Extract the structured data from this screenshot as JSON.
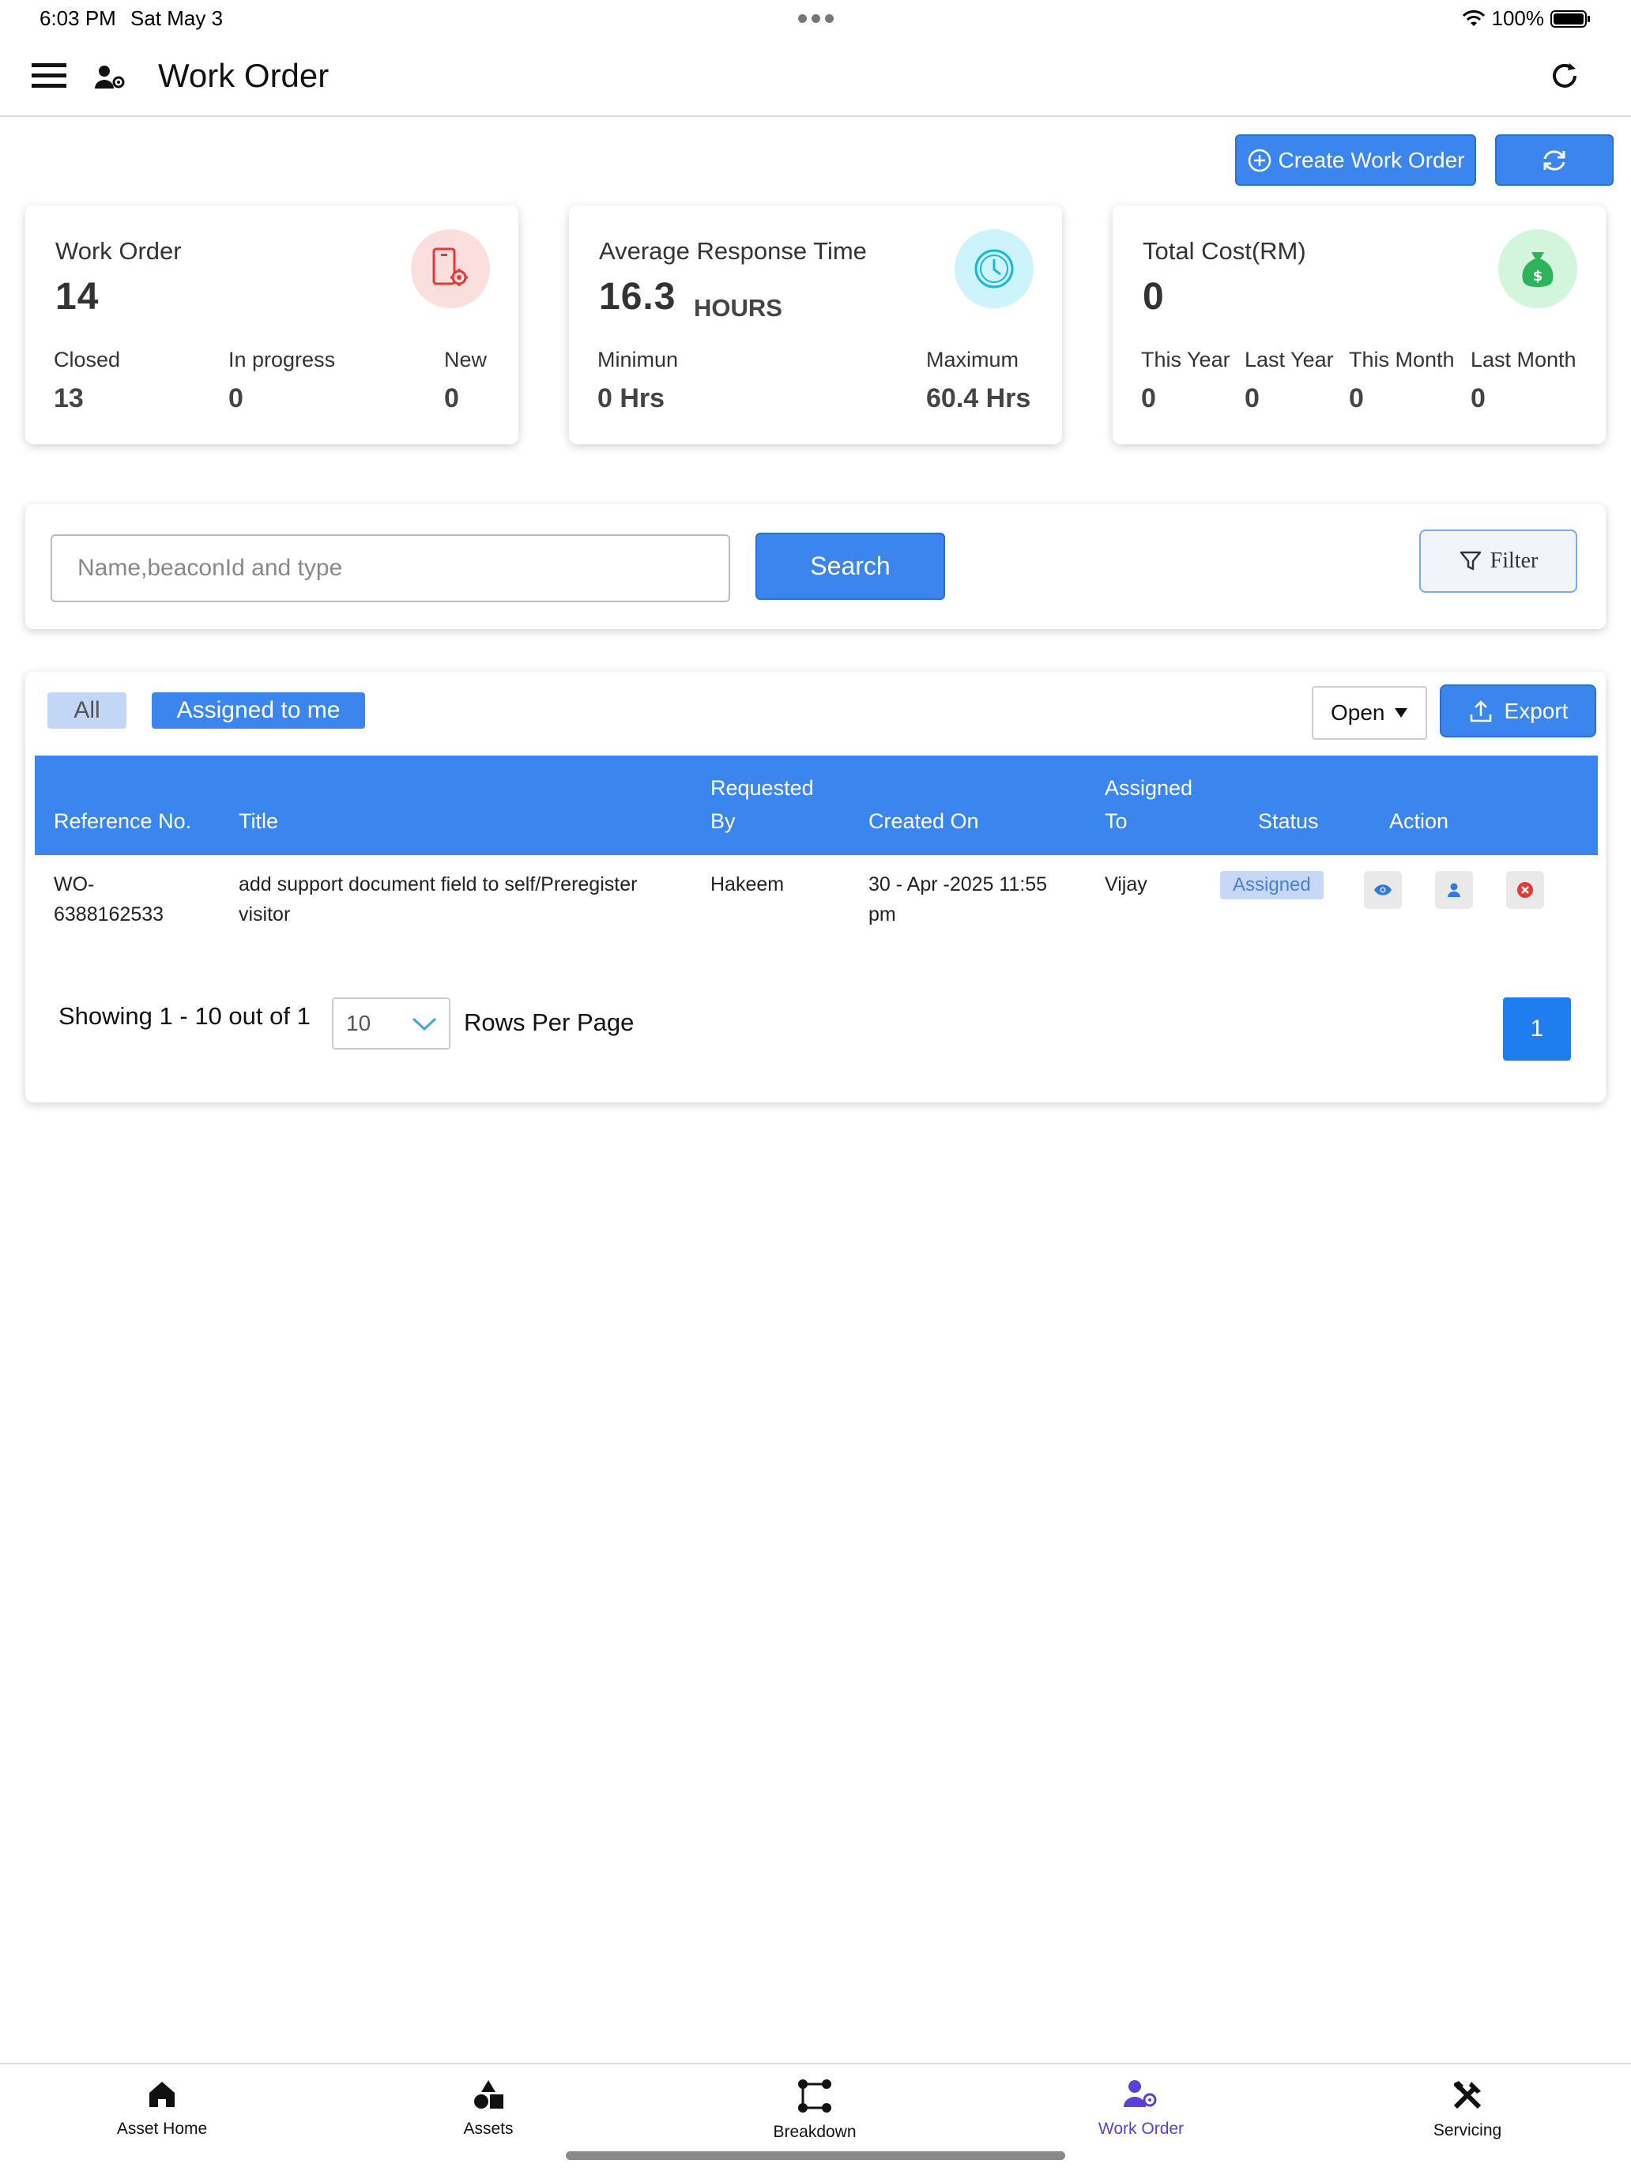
{
  "status_bar": {
    "time": "6:03 PM",
    "date": "Sat May 3",
    "battery": "100%"
  },
  "header": {
    "title": "Work Order"
  },
  "toolbar": {
    "create_label": "Create Work Order"
  },
  "cards": {
    "work_order": {
      "title": "Work Order",
      "value": "14",
      "stats": [
        {
          "label": "Closed",
          "value": "13"
        },
        {
          "label": "In progress",
          "value": "0"
        },
        {
          "label": "New",
          "value": "0"
        }
      ]
    },
    "response": {
      "title": "Average Response Time",
      "value": "16.3",
      "unit": "HOURS",
      "stats": [
        {
          "label": "Minimun",
          "value": "0 Hrs"
        },
        {
          "label": "Maximum",
          "value": "60.4 Hrs"
        }
      ]
    },
    "cost": {
      "title": "Total Cost(RM)",
      "value": "0",
      "stats": [
        {
          "label": "This Year",
          "value": "0"
        },
        {
          "label": "Last Year",
          "value": "0"
        },
        {
          "label": "This Month",
          "value": "0"
        },
        {
          "label": "Last Month",
          "value": "0"
        }
      ]
    }
  },
  "search": {
    "placeholder": "Name,beaconId and type",
    "button": "Search",
    "filter": "Filter"
  },
  "list": {
    "tabs": [
      {
        "label": "All"
      },
      {
        "label": "Assigned to me"
      }
    ],
    "status_filter": "Open",
    "export": "Export",
    "columns": {
      "ref": "Reference No.",
      "title": "Title",
      "requested_1": "Requested",
      "requested_2": "By",
      "created": "Created On",
      "assigned_1": "Assigned",
      "assigned_2": "To",
      "status": "Status",
      "action": "Action"
    },
    "rows": [
      {
        "ref_1": "WO-",
        "ref_2": "6388162533",
        "title_1": "add support document field to self/Preregister",
        "title_2": "visitor",
        "requested_by": "Hakeem",
        "created_1": "30 - Apr -2025 11:55",
        "created_2": "pm",
        "assigned_to": "Vijay",
        "status": "Assigned"
      }
    ],
    "pagination": {
      "showing": "Showing 1 - 10 out of 1",
      "rows_per_page": "10",
      "rows_label": "Rows Per Page",
      "page": "1"
    }
  },
  "bottom_nav": [
    {
      "label": "Asset Home",
      "icon": "home-icon"
    },
    {
      "label": "Assets",
      "icon": "shapes-icon"
    },
    {
      "label": "Breakdown",
      "icon": "flow-icon"
    },
    {
      "label": "Work Order",
      "icon": "user-gear-icon",
      "active": true
    },
    {
      "label": "Servicing",
      "icon": "tools-icon"
    }
  ],
  "colors": {
    "primary": "#3b86ee",
    "active_nav": "#5b3fd6",
    "danger": "#e53935",
    "success": "#2fb35a",
    "info": "#17b7d8"
  }
}
